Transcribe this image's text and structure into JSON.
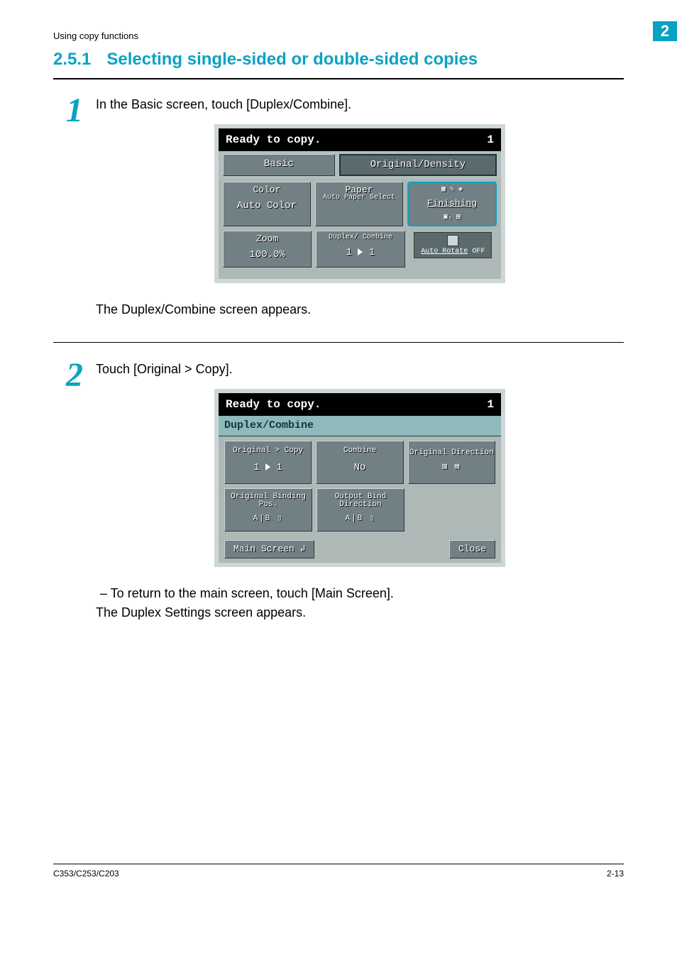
{
  "running_head": {
    "text": "Using copy functions",
    "chapter_number": "2"
  },
  "section": {
    "number": "2.5.1",
    "title": "Selecting single-sided or double-sided copies"
  },
  "step1": {
    "num": "1",
    "instruction": "In the Basic screen, touch [Duplex/Combine].",
    "after_text": "The Duplex/Combine screen appears.",
    "panel": {
      "status": "Ready to copy.",
      "copies": "1",
      "tab_basic": "Basic",
      "tab_origdens": "Original/Density",
      "color": {
        "label": "Color",
        "value": "Auto Color"
      },
      "paper": {
        "label": "Paper",
        "value": "Auto Paper Select"
      },
      "finishing": {
        "label": "Finishing"
      },
      "zoom": {
        "label": "Zoom",
        "value": "100.0%"
      },
      "duplex": {
        "label": "Duplex/ Combine",
        "value_a": "1",
        "value_b": "1"
      },
      "autorotate": {
        "label": "Auto Rotate",
        "state": "OFF"
      }
    }
  },
  "step2": {
    "num": "2",
    "instruction": "Touch [Original > Copy].",
    "bullet": "–  To return to the main screen, touch [Main Screen].",
    "after_text": "The Duplex Settings screen appears.",
    "panel": {
      "status": "Ready to copy.",
      "copies": "1",
      "title": "Duplex/Combine",
      "originalcopy": {
        "label": "Original > Copy",
        "value_a": "1",
        "value_b": "1"
      },
      "combine": {
        "label": "Combine",
        "value": "No"
      },
      "origdir": {
        "label": "Original Direction"
      },
      "origbind": {
        "label": "Original Binding Pos."
      },
      "outbind": {
        "label": "Output Bind Direction"
      },
      "main_screen_btn": "Main Screen  ↲",
      "close_btn": "Close"
    }
  },
  "footer": {
    "model": "C353/C253/C203",
    "page": "2-13"
  }
}
